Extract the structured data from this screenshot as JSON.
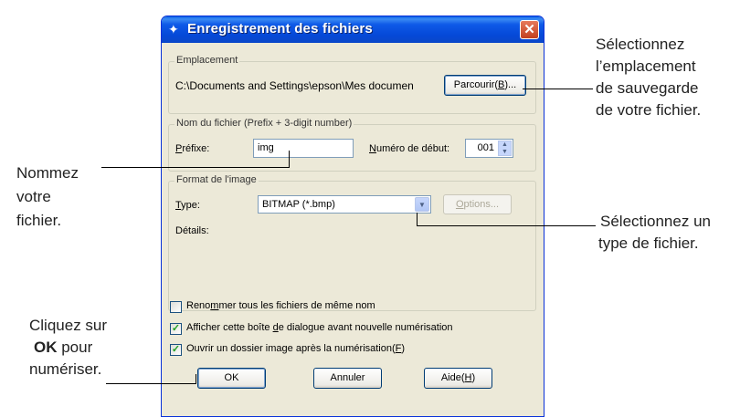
{
  "dialog": {
    "title": "Enregistrement des fichiers",
    "close_glyph": "✕",
    "location": {
      "legend": "Emplacement",
      "path": "C:\\Documents and Settings\\epson\\Mes documen",
      "browse_label_pre": "Parcourir(",
      "browse_label_key": "B",
      "browse_label_post": ")..."
    },
    "filename": {
      "legend": "Nom du fichier (Prefix + 3-digit number)",
      "prefix_key": "P",
      "prefix_rest": "réfixe:",
      "prefix_value": "img",
      "start_key": "N",
      "start_rest": "uméro de début:",
      "start_value": "001"
    },
    "format": {
      "legend": "Format de l'image",
      "type_key": "T",
      "type_rest": "ype:",
      "type_value": "BITMAP (*.bmp)",
      "options_key": "O",
      "options_rest": "ptions...",
      "details_label": "Détails:"
    },
    "checkboxes": [
      {
        "pre": "Reno",
        "key": "m",
        "post": "mer tous les fichiers de même nom",
        "checked": false
      },
      {
        "pre": "Afficher cette boîte ",
        "key": "d",
        "post": "e dialogue avant nouvelle numérisation",
        "checked": true
      },
      {
        "pre": "Ouvrir un dossier image après la numérisation(",
        "key": "F",
        "post": ")",
        "checked": true
      }
    ],
    "buttons": {
      "ok": "OK",
      "cancel": "Annuler",
      "help_pre": "Aide(",
      "help_key": "H",
      "help_post": ")"
    }
  },
  "callouts": {
    "name_file": [
      "Nommez",
      "votre",
      "fichier."
    ],
    "click_ok": {
      "line1": "Cliquez sur",
      "bold": "OK",
      "line2_rest": " pour",
      "line3": "numériser."
    },
    "location": [
      "Sélectionnez",
      "l’emplacement",
      "de sauvegarde",
      "de votre fichier."
    ],
    "type": [
      "Sélectionnez un",
      "type de fichier."
    ]
  },
  "colors": {
    "titlebar": "#0a5fe4",
    "dialog_bg": "#ece9d8",
    "close_button": "#c2401f",
    "check": "#21a121"
  }
}
